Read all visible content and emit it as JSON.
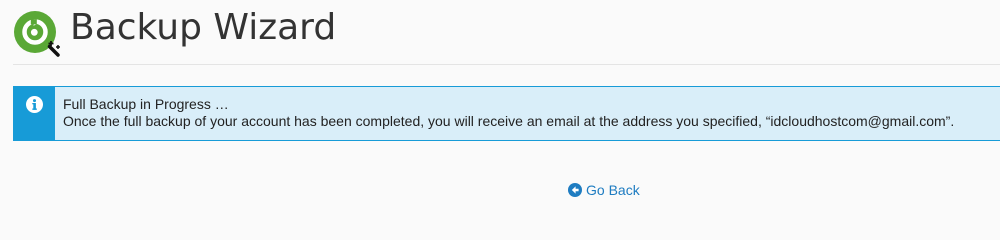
{
  "header": {
    "title": "Backup Wizard",
    "icon": "backup-wizard-icon"
  },
  "alert": {
    "icon": "info-icon",
    "title": "Full Backup in Progress …",
    "message": "Once the full backup of your account has been completed, you will receive an email at the address you specified, “idcloudhostcom@gmail.com”."
  },
  "actions": {
    "go_back_label": "Go Back",
    "go_back_icon": "arrow-circle-left-icon"
  },
  "colors": {
    "alert_accent": "#179bd7",
    "alert_background": "#d9eef9",
    "link": "#1e7cc1",
    "icon_green": "#5aa836"
  }
}
